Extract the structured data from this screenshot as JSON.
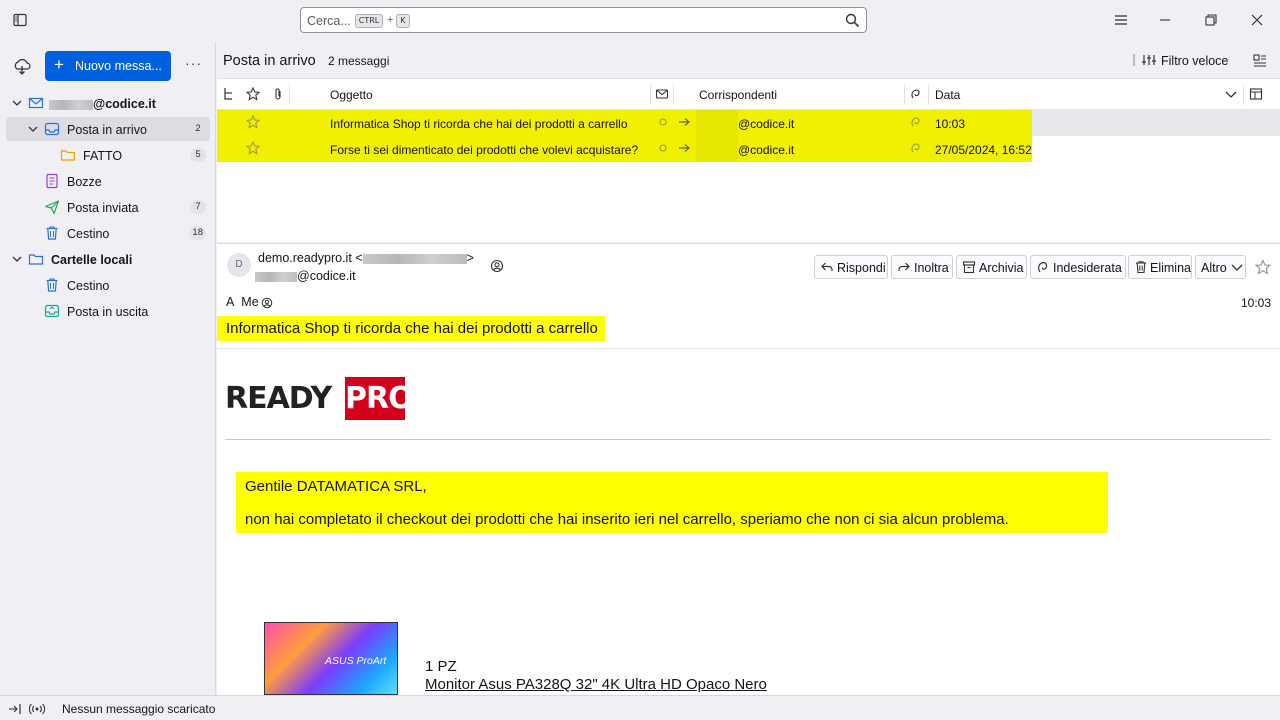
{
  "search": {
    "placeholder": "Cerca...",
    "kbd_ctrl": "CTRL",
    "kbd_plus": "+",
    "kbd_k": "K"
  },
  "toolbar": {
    "new_message_label": "Nuovo messa...",
    "more_label": "···"
  },
  "folders": {
    "account_name": "@codice.it",
    "items": [
      {
        "label": "Posta in arrivo",
        "count": "2"
      },
      {
        "label": "FATTO",
        "count": "5"
      },
      {
        "label": "Bozze",
        "count": ""
      },
      {
        "label": "Posta inviata",
        "count": "7"
      },
      {
        "label": "Cestino",
        "count": "18"
      }
    ],
    "local_folders": {
      "label": "Cartelle locali",
      "items": [
        {
          "label": "Cestino"
        },
        {
          "label": "Posta in uscita"
        }
      ]
    }
  },
  "thread_pane": {
    "folder_title": "Posta in arrivo",
    "message_count": "2 messaggi",
    "quick_filter_label": "Filtro veloce",
    "columns": {
      "subject": "Oggetto",
      "correspondents": "Corrispondenti",
      "date": "Data"
    },
    "rows": [
      {
        "subject": "Informatica Shop ti ricorda che hai dei prodotti a carrello",
        "correspondent": "@codice.it",
        "date": "10:03"
      },
      {
        "subject": "Forse ti sei dimenticato dei prodotti che volevi acquistare?",
        "correspondent": "@codice.it",
        "date": "27/05/2024, 16:52"
      }
    ]
  },
  "message_header": {
    "avatar_initial": "D",
    "from_name": "demo.readypro.it",
    "from_addr": "@codice.it",
    "buttons": {
      "reply": "Rispondi",
      "forward": "Inoltra",
      "archive": "Archivia",
      "junk": "Indesiderata",
      "delete": "Elimina",
      "other": "Altro"
    },
    "to_prefix": "A",
    "to_name": "Me",
    "time": "10:03",
    "subject": "Informatica Shop ti ricorda che hai dei prodotti a carrello"
  },
  "message_body": {
    "logo_ready": "READY",
    "logo_pro": "PRO",
    "greeting": "Gentile DATAMATICA SRL,",
    "text": "non hai completato il checkout dei prodotti che hai inserito ieri nel carrello, speriamo che non ci sia alcun problema.",
    "product_image_brand": "ASUS ProArt",
    "product_qty": "1 PZ",
    "product_name": "Monitor Asus PA328Q 32\" 4K Ultra HD Opaco Nero"
  },
  "status_bar": {
    "text": "Nessun messaggio scaricato"
  },
  "colors": {
    "accent": "#0061e0",
    "highlight": "#ffff00",
    "row_highlight": "#f1f000",
    "logo_red": "#d4001a"
  }
}
